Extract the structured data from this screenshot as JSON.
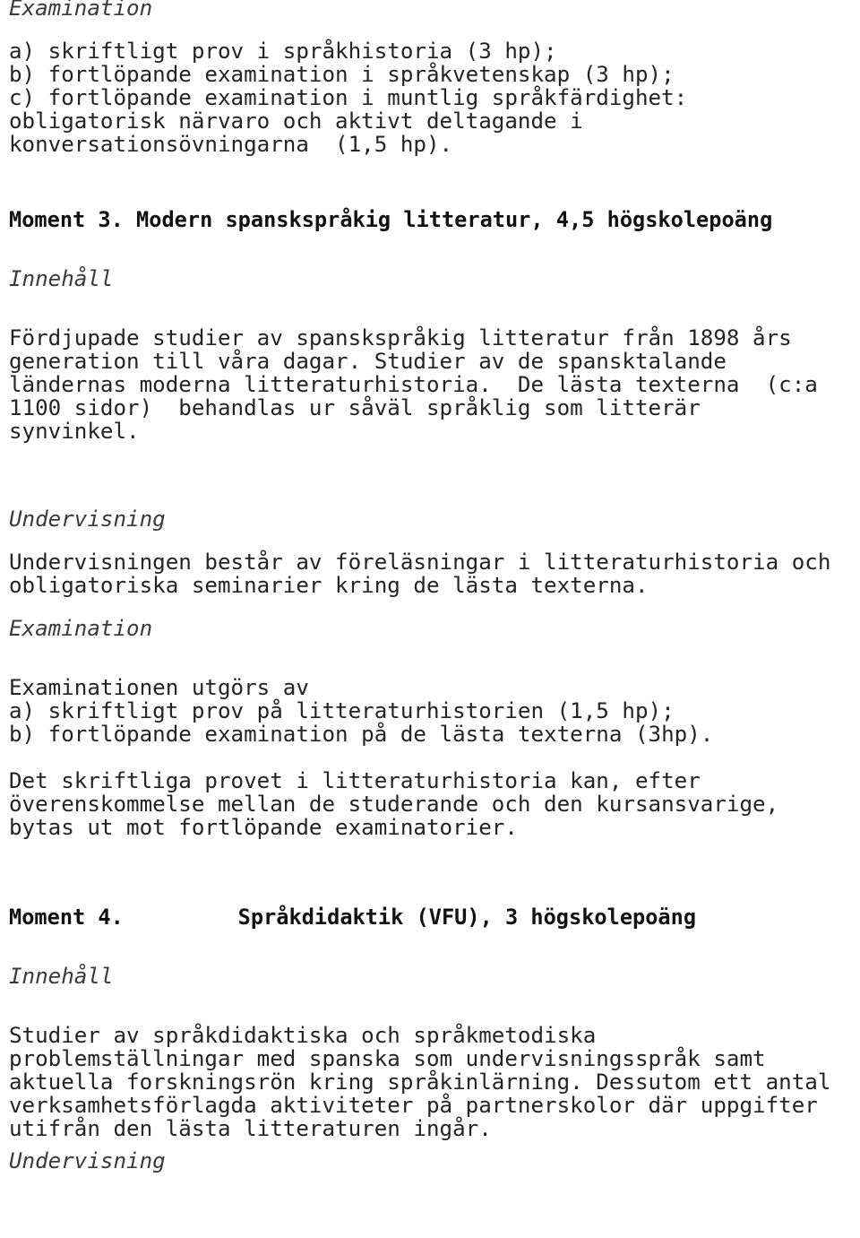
{
  "document": {
    "language": "sv",
    "text_color": "#242424",
    "background_color": "#ffffff",
    "blocks": [
      {
        "id": "examination_heading_m2",
        "kind": "section-heading",
        "style": "italic",
        "lines": [
          "Examination"
        ]
      },
      {
        "id": "examination_body_m2",
        "kind": "paragraph",
        "style": "regular",
        "lines": [
          "a) skriftligt prov i språkhistoria (3 hp);",
          "b) fortlöpande examination i språkvetenskap (3 hp);",
          "c) fortlöpande examination i muntlig språkfärdighet:",
          "obligatorisk närvaro och aktivt deltagande i",
          "konversationsövningarna  (1,5 hp)."
        ]
      },
      {
        "id": "moment3_heading",
        "kind": "moment-heading",
        "style": "bold",
        "lines": [
          "Moment 3. Modern spanskspråkig litteratur, 4,5 högskolepoäng"
        ]
      },
      {
        "id": "innehall_heading_m3",
        "kind": "section-heading",
        "style": "italic",
        "lines": [
          "Innehåll"
        ]
      },
      {
        "id": "innehall_body_m3",
        "kind": "paragraph",
        "style": "regular",
        "lines": [
          "Fördjupade studier av spanskspråkig litteratur från 1898 års",
          "generation till våra dagar. Studier av de spansktalande",
          "ländernas moderna litteraturhistoria.  De lästa texterna  (c:a",
          "1100 sidor)  behandlas ur såväl språklig som litterär",
          "synvinkel."
        ]
      },
      {
        "id": "undervisning_heading_m3",
        "kind": "section-heading",
        "style": "italic",
        "lines": [
          "Undervisning"
        ]
      },
      {
        "id": "undervisning_body_m3",
        "kind": "paragraph",
        "style": "regular",
        "lines": [
          "Undervisningen består av föreläsningar i litteraturhistoria och",
          "obligatoriska seminarier kring de lästa texterna."
        ]
      },
      {
        "id": "examination_heading_m3",
        "kind": "section-heading",
        "style": "italic",
        "lines": [
          "Examination"
        ]
      },
      {
        "id": "examination_body_m3",
        "kind": "paragraph",
        "style": "regular",
        "lines": [
          "Examinationen utgörs av",
          "a) skriftligt prov på litteraturhistorien (1,5 hp);",
          "b) fortlöpande examination på de lästa texterna (3hp)."
        ]
      },
      {
        "id": "examination_note_m3",
        "kind": "paragraph",
        "style": "regular",
        "lines": [
          "Det skriftliga provet i litteraturhistoria kan, efter",
          "överenskommelse mellan de studerande och den kursansvarige,",
          "bytas ut mot fortlöpande examinatorier."
        ]
      },
      {
        "id": "moment4_heading",
        "kind": "moment-heading",
        "style": "bold",
        "lines": [
          "Moment 4.         Språkdidaktik (VFU), 3 högskolepoäng"
        ]
      },
      {
        "id": "innehall_heading_m4",
        "kind": "section-heading",
        "style": "italic",
        "lines": [
          "Innehåll"
        ]
      },
      {
        "id": "innehall_body_m4",
        "kind": "paragraph",
        "style": "regular",
        "lines": [
          "Studier av språkdidaktiska och språkmetodiska",
          "problemställningar med spanska som undervisningsspråk samt",
          "aktuella forskningsrön kring språkinlärning. Dessutom ett antal",
          "verksamhetsförlagda aktiviteter på partnerskolor där uppgifter",
          "utifrån den lästa litteraturen ingår."
        ]
      },
      {
        "id": "undervisning_heading_m4",
        "kind": "section-heading",
        "style": "italic",
        "lines": [
          "Undervisning"
        ]
      }
    ]
  }
}
